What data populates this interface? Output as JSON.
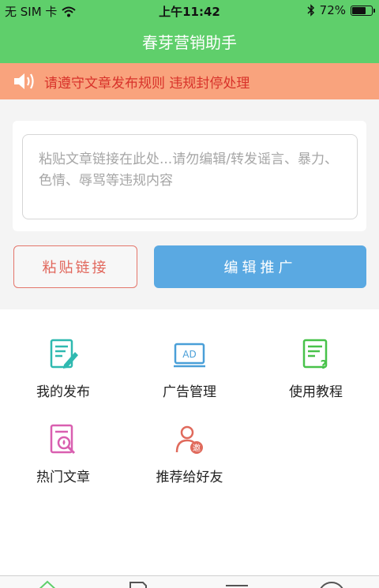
{
  "status_bar": {
    "carrier": "无 SIM 卡",
    "time": "上午11:42",
    "battery_text": "72%",
    "battery_level": 0.72,
    "icons": [
      "wifi-icon",
      "bluetooth-icon",
      "battery-icon"
    ]
  },
  "nav": {
    "title": "春芽营销助手"
  },
  "notice": {
    "icon": "speaker-icon",
    "text": "请遵守文章发布规则 违规封停处理"
  },
  "paste": {
    "placeholder": "粘贴文章链接在此处...请勿编辑/转发谣言、暴力、色情、辱骂等违规内容"
  },
  "actions": {
    "paste_label": "粘贴链接",
    "promote_label": "编辑推广"
  },
  "menu": {
    "items": [
      {
        "label": "我的发布",
        "icon": "edit-document-icon",
        "color": "#2fb9b0"
      },
      {
        "label": "广告管理",
        "icon": "ad-screen-icon",
        "color": "#4a9fd8"
      },
      {
        "label": "使用教程",
        "icon": "help-document-icon",
        "color": "#48c24a"
      },
      {
        "label": "热门文章",
        "icon": "hot-article-icon",
        "color": "#d95fb0"
      },
      {
        "label": "推荐给好友",
        "icon": "invite-friend-icon",
        "color": "#e06a5c"
      }
    ]
  },
  "colors": {
    "header": "#5fcf6b",
    "notice_bg": "#f9a37d",
    "notice_text": "#d8322a",
    "primary": "#5aa9e2",
    "secondary": "#e1665b"
  },
  "tab_bar": {
    "icons": [
      "home-icon",
      "document-icon",
      "list-icon",
      "profile-icon"
    ]
  }
}
